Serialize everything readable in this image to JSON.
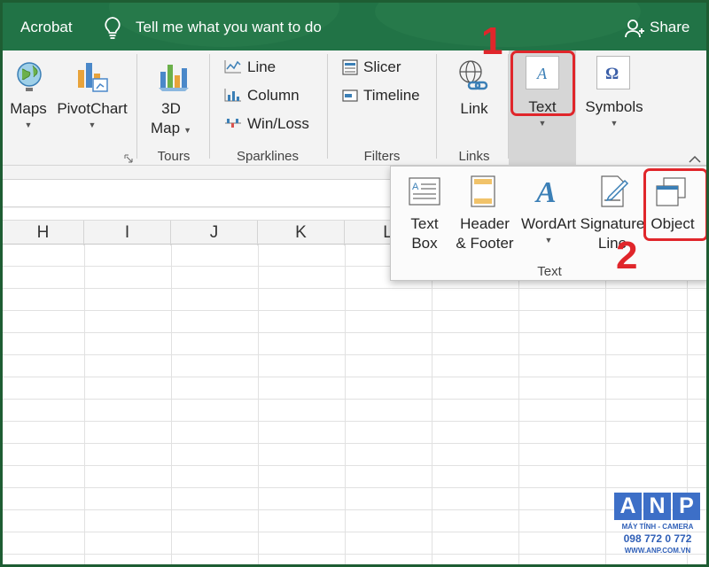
{
  "titlebar": {
    "app": "Acrobat",
    "tell_me": "Tell me what you want to do",
    "share": "Share"
  },
  "ribbon": {
    "maps": "Maps",
    "pivotchart": "PivotChart",
    "map3d_line1": "3D",
    "map3d_line2": "Map",
    "tours": "Tours",
    "sparkline_line": "Line",
    "sparkline_column": "Column",
    "sparkline_winloss": "Win/Loss",
    "sparklines": "Sparklines",
    "slicer": "Slicer",
    "timeline": "Timeline",
    "filters": "Filters",
    "link": "Link",
    "links": "Links",
    "text": "Text",
    "symbols": "Symbols"
  },
  "panel": {
    "textbox_line1": "Text",
    "textbox_line2": "Box",
    "header_line1": "Header",
    "header_line2": "& Footer",
    "wordart": "WordArt",
    "signature_line1": "Signature",
    "signature_line2": "Line",
    "object": "Object",
    "group_label": "Text"
  },
  "grid": {
    "columns": [
      "H",
      "I",
      "J",
      "K",
      "L"
    ]
  },
  "annotations": {
    "step1": "1",
    "step2": "2"
  },
  "watermark": {
    "letters": [
      "A",
      "N",
      "P"
    ],
    "line1": "MÁY TÍNH - CAMERA",
    "phone": "098 772 0 772",
    "site": "WWW.ANP.COM.VN"
  },
  "colors": {
    "accent": "#217346",
    "highlight": "#e0262b",
    "watermark": "#3d6fc7"
  }
}
